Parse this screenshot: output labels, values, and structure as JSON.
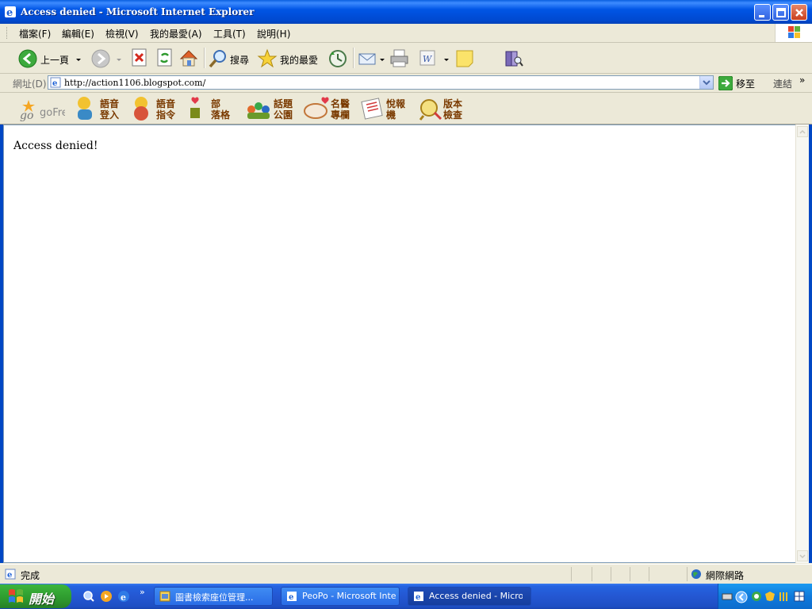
{
  "window": {
    "title": "Access denied - Microsoft Internet Explorer"
  },
  "menu": {
    "items": [
      "檔案(F)",
      "編輯(E)",
      "檢視(V)",
      "我的最愛(A)",
      "工具(T)",
      "說明(H)"
    ]
  },
  "toolbar": {
    "back_label": "上一頁",
    "search_label": "搜尋",
    "favorites_label": "我的最愛"
  },
  "address": {
    "label": "網址(D)",
    "url": "http://action1106.blogspot.com/",
    "go_label": "移至",
    "links_label": "連結",
    "chevron": "»"
  },
  "plugin_toolbar": {
    "brand": "goFree",
    "items": [
      {
        "line1": "語音",
        "line2": "登入"
      },
      {
        "line1": "語音",
        "line2": "指令"
      },
      {
        "line1": "部",
        "line2": "落格"
      },
      {
        "line1": "話題",
        "line2": "公園"
      },
      {
        "line1": "名醫",
        "line2": "專欄"
      },
      {
        "line1": "悅報",
        "line2": "機"
      },
      {
        "line1": "版本",
        "line2": "檢查"
      }
    ]
  },
  "page": {
    "message": "Access denied!"
  },
  "statusbar": {
    "status": "完成",
    "zone": "網際網路"
  },
  "taskbar": {
    "start_label": "開始",
    "tasks": [
      {
        "label": "圖書檢索座位管理..."
      },
      {
        "label": "PeoPo - Microsoft Inte..."
      },
      {
        "label": "Access denied - Micros..."
      }
    ]
  },
  "colors": {
    "titlebar": "#0055E5",
    "taskbar": "#2457D2",
    "start_button": "#2E9A2E",
    "chrome": "#ECE9D8"
  }
}
